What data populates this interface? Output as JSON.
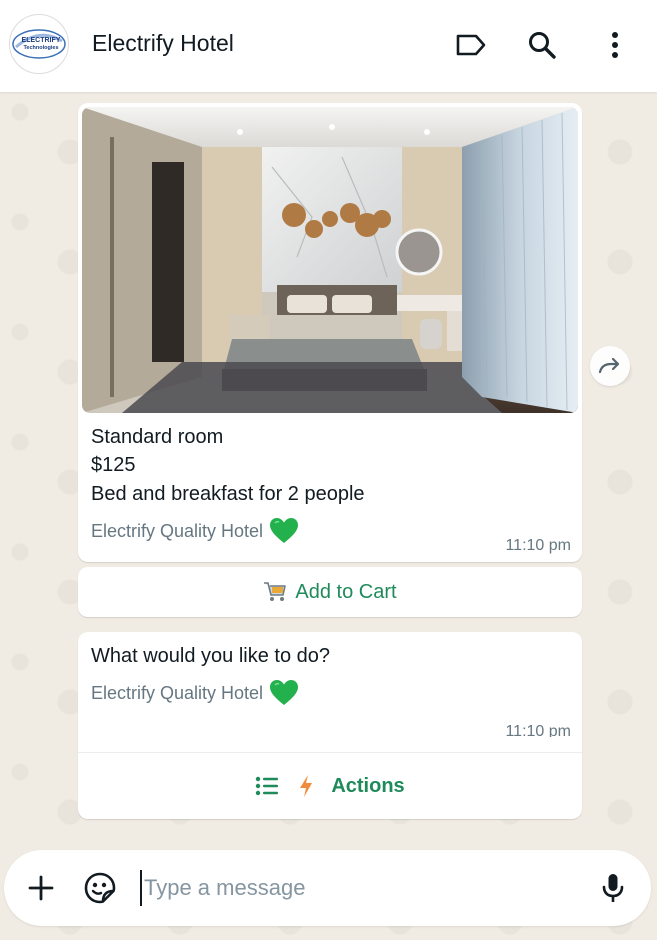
{
  "header": {
    "title": "Electrify Hotel",
    "logo_text_top": "ELECTRIFY",
    "logo_text_bottom": "Technologies",
    "icons": [
      "label-icon",
      "search-icon",
      "more-vert-icon"
    ]
  },
  "product_message": {
    "name": "Standard room",
    "price": "$125",
    "description": "Bed and breakfast for 2 people",
    "footer": "Electrify Quality Hotel",
    "time": "11:10 pm",
    "button": "Add to Cart"
  },
  "actions_message": {
    "text": "What would you like to do?",
    "footer": "Electrify Quality Hotel",
    "time": "11:10 pm",
    "button": "Actions"
  },
  "composer": {
    "placeholder": "Type a message"
  },
  "colors": {
    "accent_green": "#1f8a5a",
    "heart_green": "#22b14c",
    "background": "#efeae2"
  }
}
